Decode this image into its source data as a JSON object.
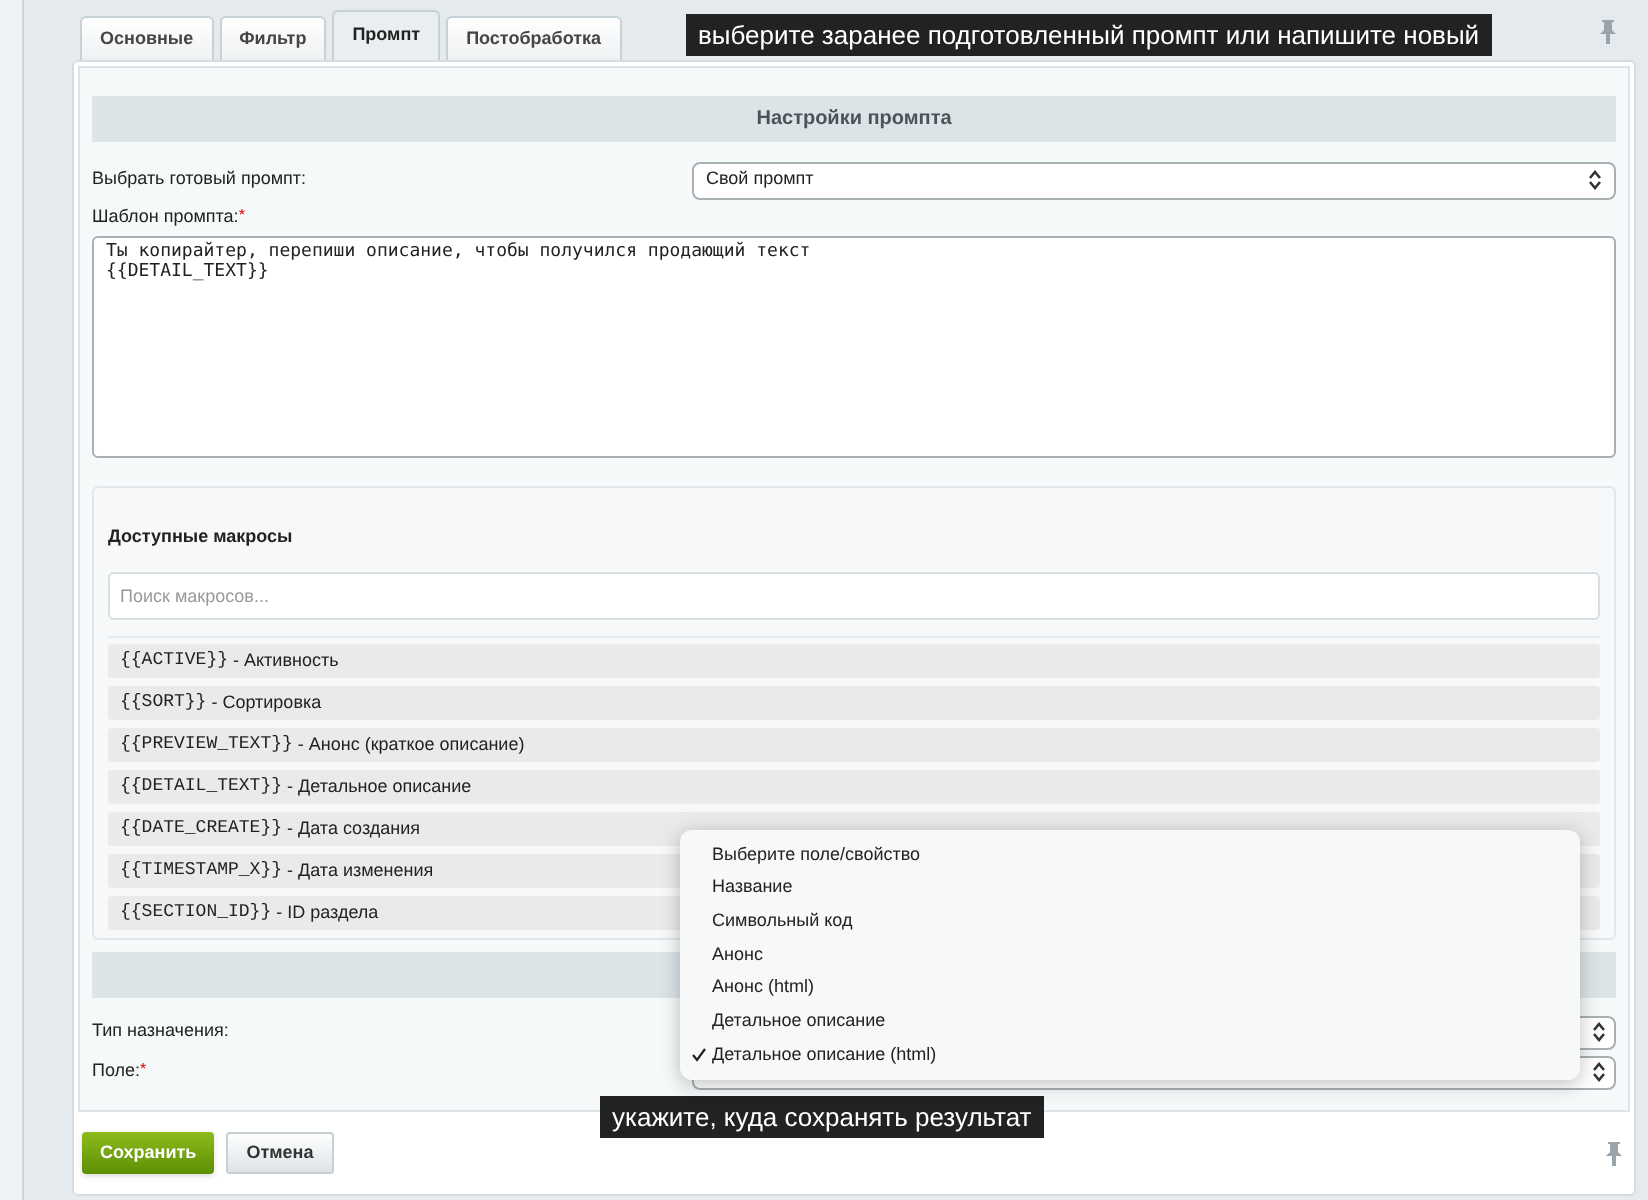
{
  "tabs": [
    {
      "label": "Основные",
      "selected": false
    },
    {
      "label": "Фильтр",
      "selected": false
    },
    {
      "label": "Промпт",
      "selected": true
    },
    {
      "label": "Постобработка",
      "selected": false
    }
  ],
  "hint_top": "выберите заранее подготовленный промпт или напишите новый",
  "section_title": "Настройки промпта",
  "preset": {
    "label": "Выбрать готовый промпт:",
    "value": "Свой промпт"
  },
  "template": {
    "label": "Шаблон промпта:",
    "required_mark": "*",
    "value": "Ты копирайтер, перепиши описание, чтобы получился продающий текст\n{{DETAIL_TEXT}}"
  },
  "macros": {
    "title": "Доступные макросы",
    "search_placeholder": "Поиск макросов...",
    "items": [
      {
        "code": "{{ACTIVE}}",
        "desc": " - Активность"
      },
      {
        "code": "{{SORT}}",
        "desc": " - Сортировка"
      },
      {
        "code": "{{PREVIEW_TEXT}}",
        "desc": " - Анонс (краткое описание)"
      },
      {
        "code": "{{DETAIL_TEXT}}",
        "desc": " - Детальное описание"
      },
      {
        "code": "{{DATE_CREATE}}",
        "desc": " - Дата создания"
      },
      {
        "code": "{{TIMESTAMP_X}}",
        "desc": " - Дата изменения"
      },
      {
        "code": "{{SECTION_ID}}",
        "desc": " - ID раздела"
      }
    ]
  },
  "target_type": {
    "label": "Тип назначения:"
  },
  "field": {
    "label": "Поле:",
    "required_mark": "*"
  },
  "field_dropdown": [
    {
      "label": "Выберите поле/свойство",
      "selected": false
    },
    {
      "label": "Название",
      "selected": false
    },
    {
      "label": "Символьный код",
      "selected": false
    },
    {
      "label": "Анонс",
      "selected": false
    },
    {
      "label": "Анонс (html)",
      "selected": false
    },
    {
      "label": "Детальное описание",
      "selected": false
    },
    {
      "label": "Детальное описание (html)",
      "selected": true
    }
  ],
  "hint_bottom": "укажите, куда сохранять результат",
  "buttons": [
    {
      "label": "Сохранить",
      "kind": "primary"
    },
    {
      "label": "Отмена",
      "kind": "secondary"
    }
  ]
}
